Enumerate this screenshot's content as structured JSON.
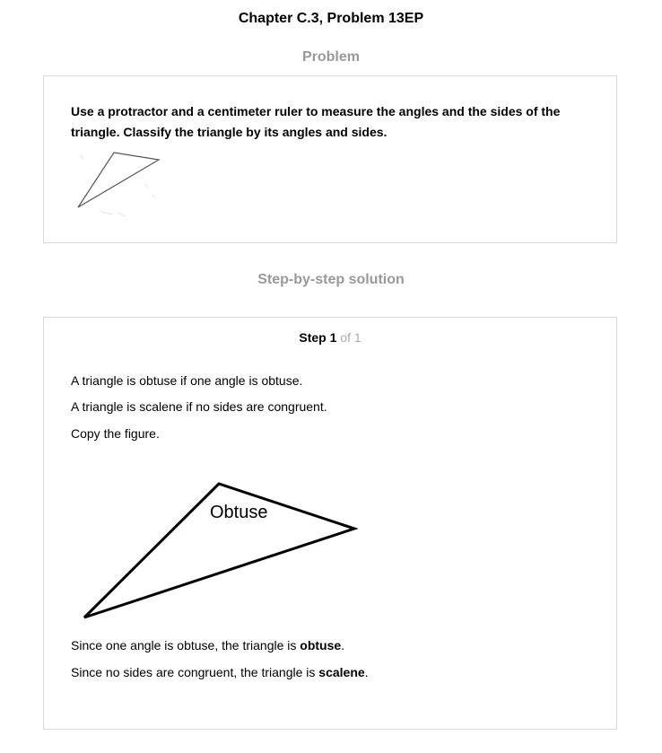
{
  "title": "Chapter C.3, Problem 13EP",
  "problem": {
    "heading": "Problem",
    "text": "Use a protractor and a centimeter ruler to measure the angles and the sides of the triangle. Classify the triangle by its angles and sides."
  },
  "solution": {
    "heading": "Step-by-step solution",
    "step_word": "Step",
    "step_number": "1",
    "step_of": "of 1",
    "lines": [
      "A triangle is obtuse if one angle is obtuse.",
      "A triangle is scalene if no sides are congruent.",
      "Copy the figure."
    ],
    "figure_label": "Obtuse",
    "conclusion_1": {
      "prefix": "Since one angle is obtuse, the triangle is ",
      "bold": "obtuse",
      "suffix": "."
    },
    "conclusion_2": {
      "prefix": "Since no sides are congruent, the triangle is ",
      "bold": "scalene",
      "suffix": "."
    }
  }
}
